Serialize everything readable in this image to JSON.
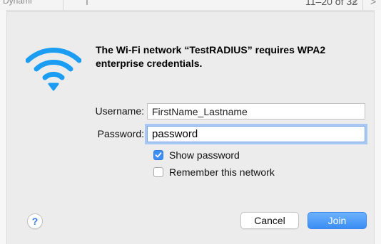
{
  "background": {
    "fragments": [
      "Dynami",
      "I",
      "11–20 of 32",
      "<",
      ">"
    ]
  },
  "dialog": {
    "icon": "wifi-icon",
    "message": "The Wi-Fi network “TestRADIUS” requires WPA2 enterprise credentials.",
    "username_label": "Username:",
    "username_value": "FirstName_Lastname",
    "password_label": "Password:",
    "password_value": "password",
    "show_password_label": "Show password",
    "show_password_checked": true,
    "remember_label": "Remember this network",
    "remember_checked": false,
    "help_label": "?",
    "cancel_label": "Cancel",
    "join_label": "Join"
  },
  "colors": {
    "accent": "#3d8ef5",
    "wifi_icon": "#1a9df2",
    "dialog_bg": "#ececec"
  }
}
